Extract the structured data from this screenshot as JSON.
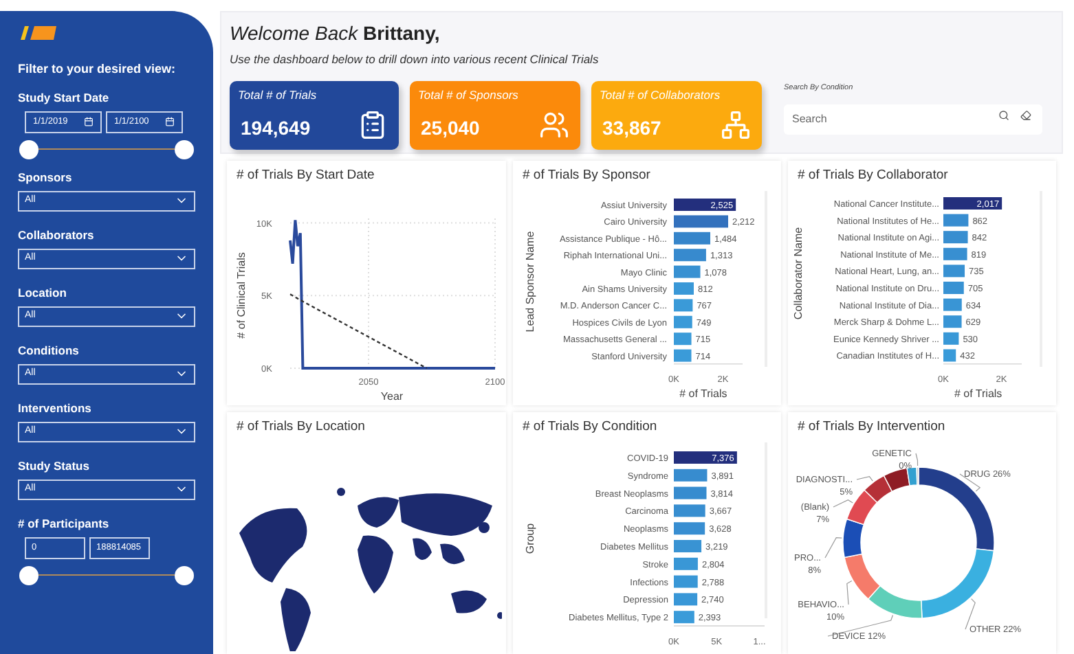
{
  "sidebar": {
    "heading": "Filter to your desired view:",
    "filters": [
      {
        "kind": "date_range",
        "label": "Study Start Date",
        "from": "1/1/2019",
        "to": "1/1/2100"
      },
      {
        "kind": "dropdown",
        "label": "Sponsors",
        "value": "All"
      },
      {
        "kind": "dropdown",
        "label": "Collaborators",
        "value": "All"
      },
      {
        "kind": "dropdown",
        "label": "Location",
        "value": "All"
      },
      {
        "kind": "dropdown",
        "label": "Conditions",
        "value": "All"
      },
      {
        "kind": "dropdown",
        "label": "Interventions",
        "value": "All"
      },
      {
        "kind": "dropdown",
        "label": "Study Status",
        "value": "All"
      },
      {
        "kind": "number_range",
        "label": "# of Participants",
        "from": "0",
        "to": "188814085"
      }
    ]
  },
  "header": {
    "greeting": "Welcome Back",
    "name": "Brittany,",
    "subtitle": "Use the dashboard below to drill down into various recent Clinical Trials"
  },
  "kpis": [
    {
      "kind": "list",
      "label": "Total # of Trials",
      "value": "194,649",
      "color": "#22489a"
    },
    {
      "kind": "people",
      "label": "Total # of Sponsors",
      "value": "25,040",
      "color": "#fb8a0b"
    },
    {
      "kind": "network",
      "label": "Total # of Collaborators",
      "value": "33,867",
      "color": "#fcaa0e"
    }
  ],
  "search": {
    "label": "Search By Condition",
    "placeholder": "Search"
  },
  "panels": [
    {
      "title": "# of Trials By Start Date",
      "chart_data": {
        "type": "line",
        "xlabel": "Year",
        "ylabel": "# of Clinical Trials",
        "x": [
          2019,
          2020,
          2021,
          2022,
          2023,
          2024,
          2073,
          2100
        ],
        "series": [
          {
            "color": "#2a4a9c",
            "line_style": "solid",
            "values": [
              8800,
              7200,
              10200,
              8400,
              9300,
              0,
              0,
              0
            ]
          },
          {
            "color": "#333333",
            "line_style": "dashed",
            "values": [
              5100,
              5000,
              4900,
              4800,
              4700,
              4600,
              0,
              null
            ]
          }
        ],
        "grid": true,
        "xlim": [
          2019,
          2100
        ],
        "ylim": [
          0,
          10500
        ],
        "xticks": [
          2050,
          2100
        ],
        "yticks": [
          {
            "value": 0,
            "label": "0K"
          },
          {
            "value": 5000,
            "label": "5K"
          },
          {
            "value": 10000,
            "label": "10K"
          }
        ]
      }
    },
    {
      "title": "# of Trials By Sponsor",
      "chart_data": {
        "type": "bar",
        "orientation": "horizontal",
        "xlabel": "# of Trials",
        "ylabel": "Lead Sponsor Name",
        "categories": [
          "Assiut University",
          "Cairo University",
          "Assistance Publique - Hô...",
          "Riphah International Uni...",
          "Mayo Clinic",
          "Ain Shams University",
          "M.D. Anderson Cancer C...",
          "Hospices Civils de Lyon",
          "Massachusetts General ...",
          "Stanford University"
        ],
        "values": [
          2525,
          2212,
          1484,
          1313,
          1078,
          812,
          767,
          749,
          715,
          714
        ],
        "value_labels": [
          "2,525",
          "2,212",
          "1,484",
          "1,313",
          "1,078",
          "812",
          "767",
          "749",
          "715",
          "714"
        ],
        "data_labels": true,
        "xlim": [
          0,
          2800
        ],
        "xticks": [
          {
            "value": 0,
            "label": "0K"
          },
          {
            "value": 2000,
            "label": "2K"
          }
        ]
      }
    },
    {
      "title": "# of Trials By Collaborator",
      "chart_data": {
        "type": "bar",
        "orientation": "horizontal",
        "xlabel": "# of Trials",
        "ylabel": "Collaborator Name",
        "categories": [
          "National Cancer Institute...",
          "National Institutes of He...",
          "National Institute on Agi...",
          "National Institute of Me...",
          "National Heart, Lung, an...",
          "National Institute on Dru...",
          "National Institute of Dia...",
          "Merck Sharp & Dohme L...",
          "Eunice Kennedy Shriver ...",
          "Canadian Institutes of H..."
        ],
        "values": [
          2017,
          862,
          842,
          819,
          735,
          705,
          634,
          629,
          530,
          432
        ],
        "value_labels": [
          "2,017",
          "862",
          "842",
          "819",
          "735",
          "705",
          "634",
          "629",
          "530",
          "432"
        ],
        "data_labels": true,
        "xlim": [
          0,
          2700
        ],
        "xticks": [
          {
            "value": 0,
            "label": "0K"
          },
          {
            "value": 2000,
            "label": "2K"
          }
        ]
      }
    },
    {
      "kind": "picture",
      "title": "# of Trials By Location"
    },
    {
      "title": "# of Trials By Condition",
      "chart_data": {
        "type": "bar",
        "orientation": "horizontal",
        "ylabel": "Group",
        "categories": [
          "COVID-19",
          "Syndrome",
          "Breast Neoplasms",
          "Carcinoma",
          "Neoplasms",
          "Diabetes Mellitus",
          "Stroke",
          "Infections",
          "Depression",
          "Diabetes Mellitus, Type 2"
        ],
        "values": [
          7376,
          3891,
          3814,
          3667,
          3628,
          3219,
          2804,
          2788,
          2740,
          2393
        ],
        "value_labels": [
          "7,376",
          "3,891",
          "3,814",
          "3,667",
          "3,628",
          "3,219",
          "2,804",
          "2,788",
          "2,740",
          "2,393"
        ],
        "xlim": [
          0,
          10600
        ],
        "xticks": [
          {
            "value": 0,
            "label": "0K"
          },
          {
            "value": 5000,
            "label": "5K"
          },
          {
            "value": 10000,
            "label": "1..."
          }
        ]
      }
    },
    {
      "title": "# of Trials By Intervention",
      "chart_data": {
        "type": "donut",
        "categories": [
          "DRUG",
          "OTHER",
          "DEVICE",
          "BEHAVIO...",
          "PRO...",
          "(Blank)",
          "DIAGNOSTI...",
          null,
          null,
          "GENETIC"
        ],
        "values": [
          26,
          22,
          12,
          10,
          8,
          7,
          5,
          5,
          2,
          0.4
        ],
        "value_labels": [
          "26%",
          "22%",
          "12%",
          "10%",
          "8%",
          "7%",
          "5%",
          null,
          null,
          "0%"
        ]
      }
    }
  ]
}
